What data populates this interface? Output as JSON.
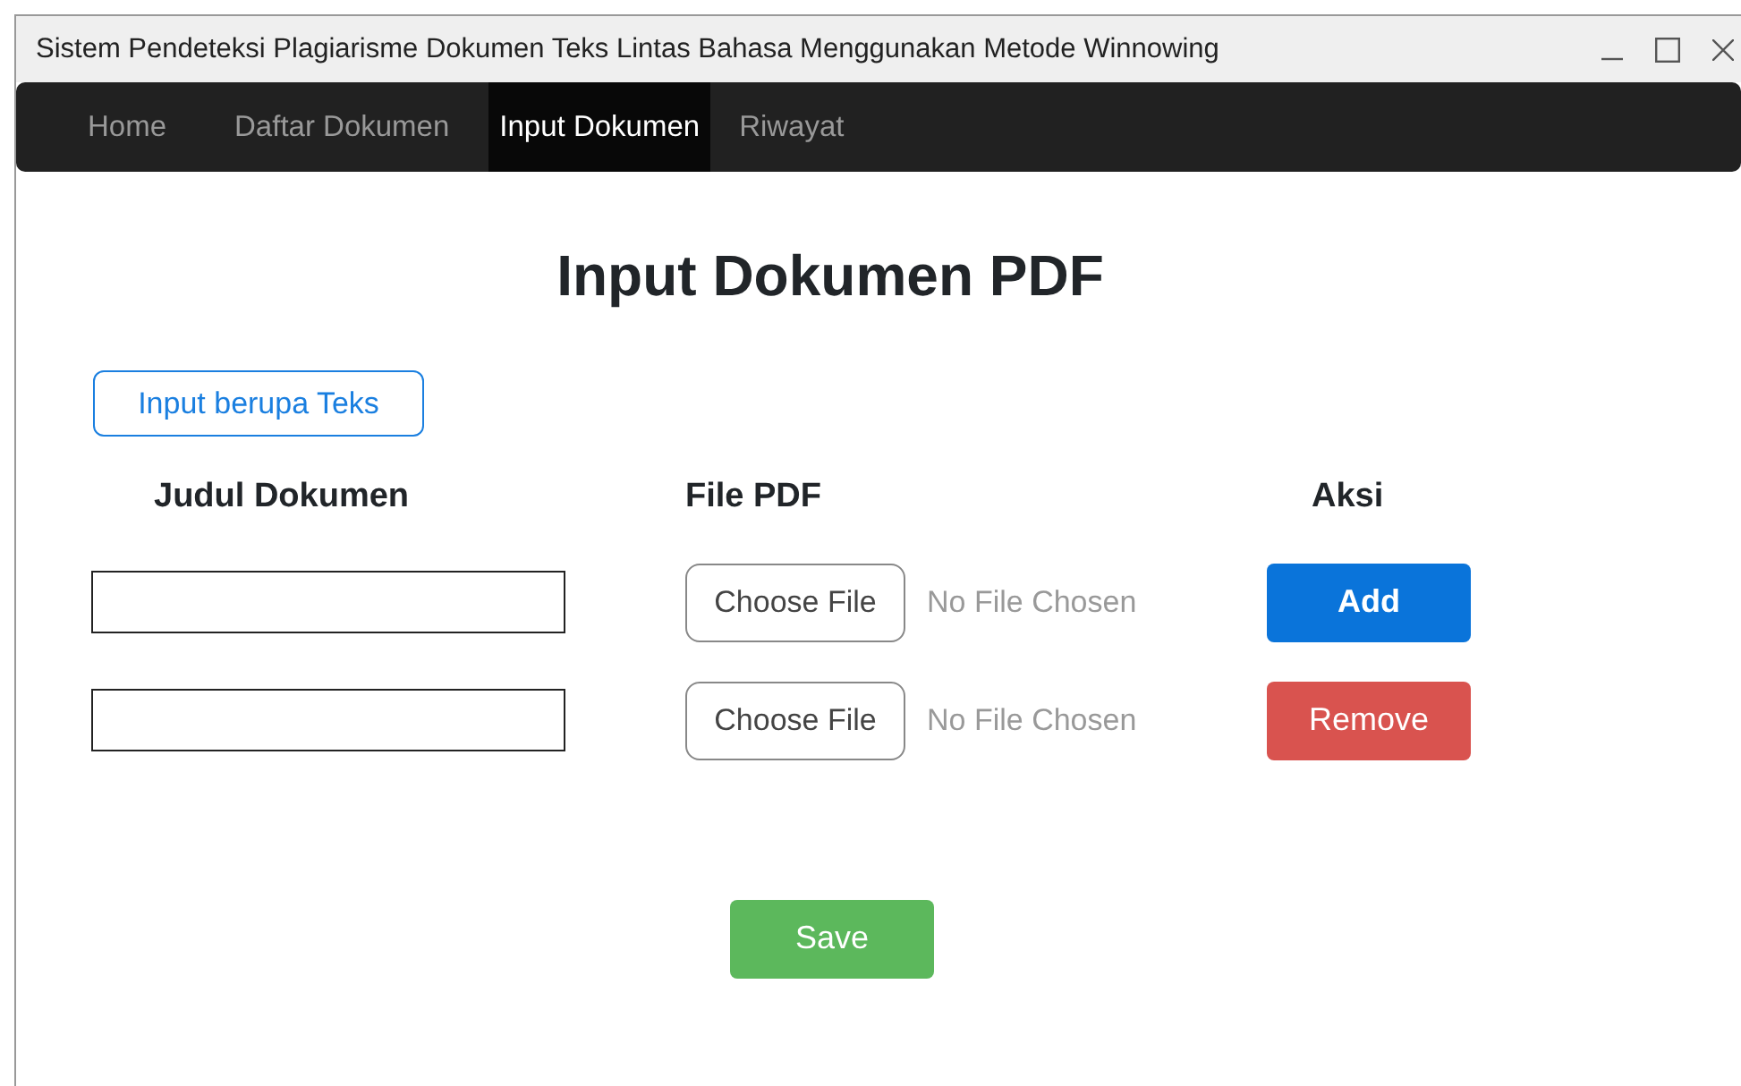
{
  "window": {
    "title": "Sistem Pendeteksi Plagiarisme Dokumen Teks Lintas Bahasa Menggunakan Metode Winnowing"
  },
  "nav": [
    {
      "label": "Home",
      "selected": false
    },
    {
      "label": "Daftar Dokumen",
      "selected": false
    },
    {
      "label": "Input Dokumen",
      "selected": true
    },
    {
      "label": "Riwayat",
      "selected": false
    }
  ],
  "heading": "Input Dokumen PDF",
  "mode_button": "Input berupa Teks",
  "columns": [
    "Judul Dokumen",
    "File PDF",
    "Aksi"
  ],
  "rows": [
    {
      "file_button": "Choose File",
      "file_status": "No File Chosen",
      "action": {
        "label": "Add",
        "kind": "add"
      }
    },
    {
      "file_button": "Choose File",
      "file_status": "No File Chosen",
      "action": {
        "label": "Remove",
        "kind": "remove"
      }
    }
  ],
  "save_button": "Save"
}
